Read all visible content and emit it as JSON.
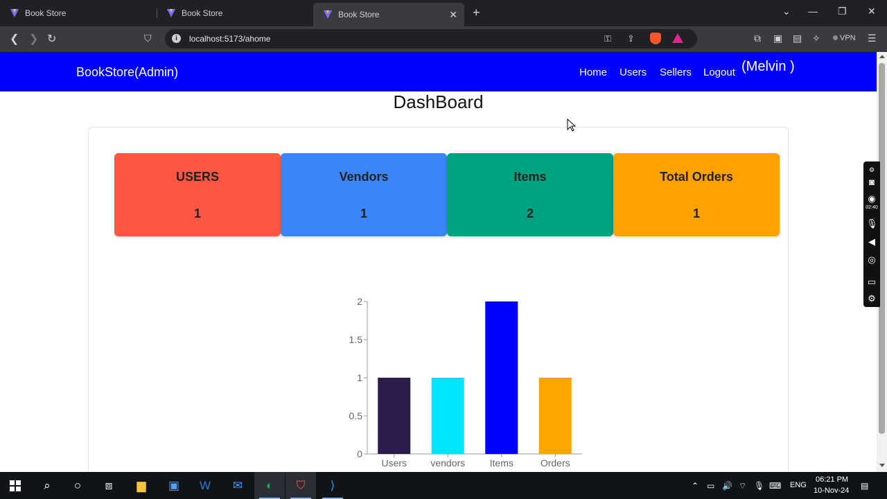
{
  "browser": {
    "tabs": [
      {
        "title": "Book Store",
        "active": false
      },
      {
        "title": "Book Store",
        "active": false
      },
      {
        "title": "Book Store",
        "active": true
      }
    ],
    "url": "localhost:5173/ahome",
    "vpn_label": "VPN"
  },
  "navbar": {
    "brand": "BookStore(Admin)",
    "links": [
      "Home",
      "Users",
      "Sellers",
      "Logout"
    ],
    "user": "(Melvin )",
    "color": "#0000ff"
  },
  "dashboard": {
    "title": "DashBoard",
    "cards": [
      {
        "label": "USERS",
        "value": "1",
        "color": "#ff5543"
      },
      {
        "label": "Vendors",
        "value": "1",
        "color": "#3a86f8"
      },
      {
        "label": "Items",
        "value": "2",
        "color": "#00a27f"
      },
      {
        "label": "Total Orders",
        "value": "1",
        "color": "#ffa103"
      }
    ]
  },
  "chart_data": {
    "type": "bar",
    "categories": [
      "Users",
      "vendors",
      "Items",
      "Orders"
    ],
    "values": [
      1,
      1,
      2,
      1
    ],
    "colors": [
      "#2d1b4e",
      "#00e5ff",
      "#0000ff",
      "#ffa500"
    ],
    "ylim": [
      0,
      2
    ],
    "yticks": [
      "0",
      "0.5",
      "1",
      "1.5",
      "2"
    ],
    "grid": false,
    "title": "",
    "xlabel": "",
    "ylabel": ""
  },
  "recorder": {
    "time": "02:40"
  },
  "taskbar": {
    "language": "ENG",
    "time": "06:21 PM",
    "date": "10-Nov-24"
  }
}
